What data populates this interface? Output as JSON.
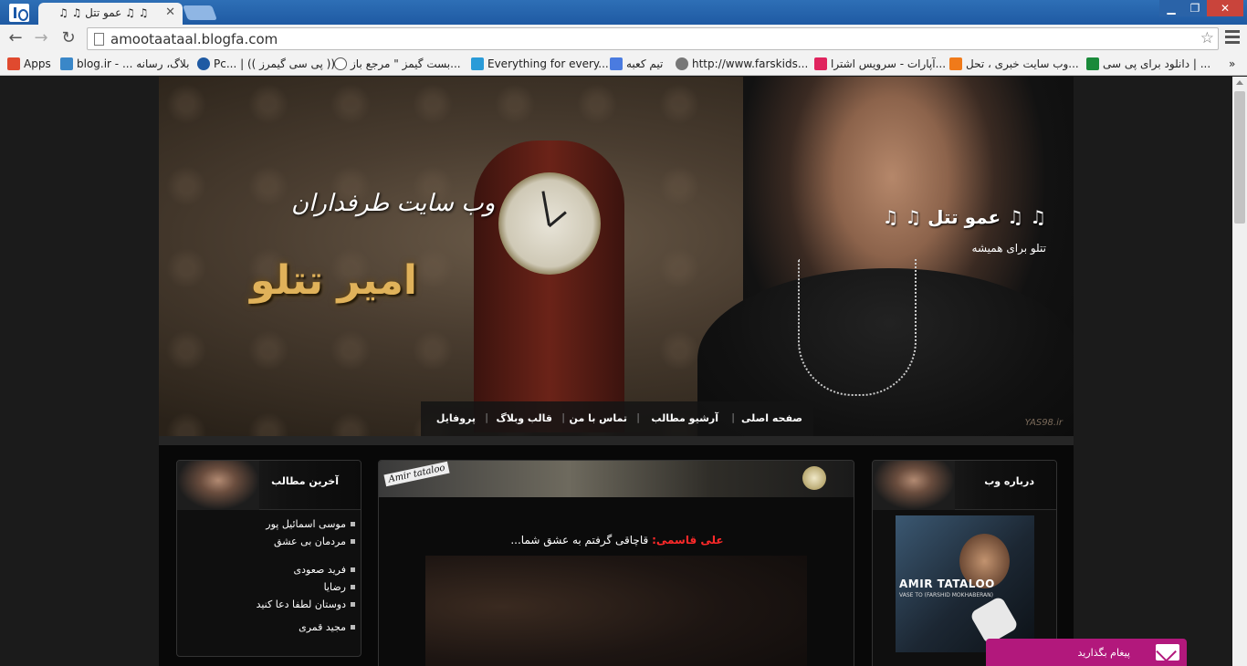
{
  "browser": {
    "tab_title": "♫ ♫ عمو تتل ♫ ♫",
    "url": "amootaataal.blogfa.com",
    "bookmarks": [
      {
        "label": "Apps",
        "icon": "apps-grid-icon",
        "color": "#e04a2f"
      },
      {
        "label": "blog.ir - ... بلاگ، رسانه",
        "icon": "blogir-icon",
        "color": "#3a87c8"
      },
      {
        "label": "Pc... | (( پی سی گیمرز ))",
        "icon": "pcgamers-icon",
        "color": "#1f5aa3"
      },
      {
        "label": "بست گیمز \" مرجع باز...",
        "icon": "bestgames-icon",
        "color": "#555555"
      },
      {
        "label": "Everything for every...",
        "icon": "everything-icon",
        "color": "#2a9bd8"
      },
      {
        "label": "تیم کعبه",
        "icon": "google-icon",
        "color": "#4a7be0"
      },
      {
        "label": "http://www.farskids...",
        "icon": "farskids-icon",
        "color": "#777777"
      },
      {
        "label": "آپارات - سرویس اشترا...",
        "icon": "aparat-icon",
        "color": "#e0245e"
      },
      {
        "label": "وب سایت خبری ، تحل...",
        "icon": "news-icon",
        "color": "#f07a1a"
      },
      {
        "label": "دانلود برای پی سی | ...",
        "icon": "pc-download-icon",
        "color": "#1a8a3a"
      }
    ],
    "more": "»"
  },
  "header": {
    "title": "♫ ♫ عمو تتل ♫ ♫",
    "subtitle": "تتلو برای همیشه",
    "fans_text": "وب سایت طرفداران",
    "name_text": "امیر تتلو",
    "watermark": "YAS98.ir",
    "nav": [
      "صفحه اصلی",
      "آرشیو مطالب",
      "تماس با من",
      "قالب وبلاگ",
      "پروفایل"
    ]
  },
  "left_box": {
    "title": "آخرین مطالب",
    "items": [
      "موسی اسمائیل پور",
      "مردمان بی عشق",
      "فرید صعودی",
      "رضایا",
      "دوستان لطفا دعا کنید",
      "مجید قمری"
    ]
  },
  "center_box": {
    "tag": "Amir tataloo",
    "post_author": "علی قاسمی:",
    "post_text": " قاچاقی گرفتم به عشق شما..."
  },
  "right_box": {
    "title": "درباره وب",
    "album_title": "AMIR TATALOO",
    "album_sub": "VASE TO (FARSHID MOKHABERAN)"
  },
  "message_widget": {
    "label": "پیغام بگذارید"
  }
}
